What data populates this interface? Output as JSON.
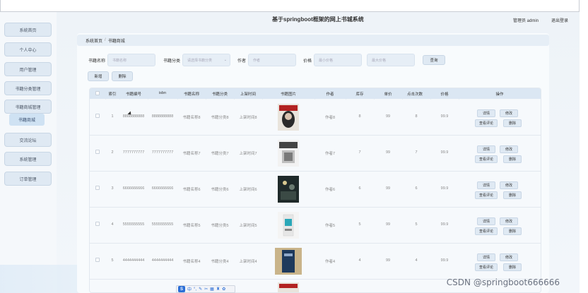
{
  "header": {
    "title": "基于springboot框架的网上书城系统",
    "user_label": "管理员 admin",
    "logout_label": "退出登录"
  },
  "sidebar": {
    "items": [
      {
        "label": "系统首页"
      },
      {
        "label": "个人中心"
      },
      {
        "label": "用户管理"
      },
      {
        "label": "书籍分类管理"
      },
      {
        "label": "书籍商城管理"
      },
      {
        "label": "书籍商城"
      },
      {
        "label": "交流论坛"
      },
      {
        "label": "系统管理"
      },
      {
        "label": "订单管理"
      }
    ]
  },
  "breadcrumb": {
    "home": "系统首页",
    "current": "书籍商城"
  },
  "filters": {
    "name_label": "书籍名称",
    "name_placeholder": "书籍名称",
    "category_label": "书籍分类",
    "category_placeholder": "请选择书籍分类",
    "author_label": "作者",
    "author_placeholder": "作者",
    "price_label": "价格",
    "price_min_placeholder": "最小价格",
    "price_max_placeholder": "最大价格",
    "search_label": "查询"
  },
  "toolbar": {
    "add_label": "新增",
    "delete_label": "删除"
  },
  "table": {
    "headers": [
      "索引",
      "书籍编号",
      "isbn",
      "书籍名称",
      "书籍分类",
      "上架时间",
      "书籍图片",
      "作者",
      "库存",
      "单价",
      "点击次数",
      "价格",
      "操作"
    ],
    "rows": [
      {
        "index": "1",
        "code": "8888888888",
        "isbn": "8888888888",
        "name": "书籍名称8",
        "category": "书籍分类8",
        "time": "上架时间8",
        "author": "作者8",
        "stock": "8",
        "unit": "99",
        "clicks": "8",
        "price": "99.9"
      },
      {
        "index": "2",
        "code": "7777777777",
        "isbn": "7777777777",
        "name": "书籍名称7",
        "category": "书籍分类7",
        "time": "上架时间7",
        "author": "作者7",
        "stock": "7",
        "unit": "99",
        "clicks": "7",
        "price": "99.9"
      },
      {
        "index": "3",
        "code": "6666666666",
        "isbn": "6666666666",
        "name": "书籍名称6",
        "category": "书籍分类6",
        "time": "上架时间6",
        "author": "作者6",
        "stock": "6",
        "unit": "99",
        "clicks": "6",
        "price": "99.9"
      },
      {
        "index": "4",
        "code": "5555555555",
        "isbn": "5555555555",
        "name": "书籍名称5",
        "category": "书籍分类5",
        "time": "上架时间5",
        "author": "作者5",
        "stock": "5",
        "unit": "99",
        "clicks": "5",
        "price": "99.9"
      },
      {
        "index": "5",
        "code": "4444444444",
        "isbn": "4444444444",
        "name": "书籍名称4",
        "category": "书籍分类4",
        "time": "上架时间4",
        "author": "作者4",
        "stock": "4",
        "unit": "99",
        "clicks": "4",
        "price": "99.9"
      }
    ],
    "actions": {
      "detail": "详情",
      "edit": "修改",
      "comments": "查看评论",
      "delete": "删除"
    }
  },
  "watermark": "CSDN @springboot666666",
  "ime": {
    "logo": "S",
    "mode": "中"
  },
  "colors": {
    "accent": "#dfe9f3",
    "header_bg": "#dbe7f3",
    "ime_blue": "#2b6ed6"
  }
}
